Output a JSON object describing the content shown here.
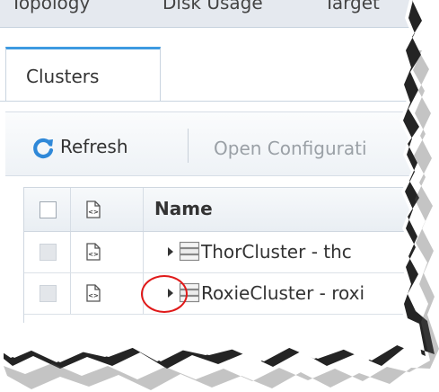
{
  "top_tabs": [
    "Topology",
    "Disk Usage",
    "Target"
  ],
  "tabs": [
    {
      "label": "Clusters"
    }
  ],
  "toolbar": {
    "refresh_label": "Refresh",
    "open_configuration_label": "Open Configurati"
  },
  "grid": {
    "header": {
      "name_label": "Name"
    },
    "rows": [
      {
        "name": "ThorCluster - thc"
      },
      {
        "name": "RoxieCluster - roxi"
      }
    ]
  },
  "icons": {
    "refresh": "refresh-icon",
    "document": "document-icon",
    "database": "database-icon",
    "expand": "expand-arrow-icon"
  },
  "colors": {
    "accent": "#3d9ae1",
    "highlight": "#e01919",
    "top_bar": "#e5e9ef"
  }
}
